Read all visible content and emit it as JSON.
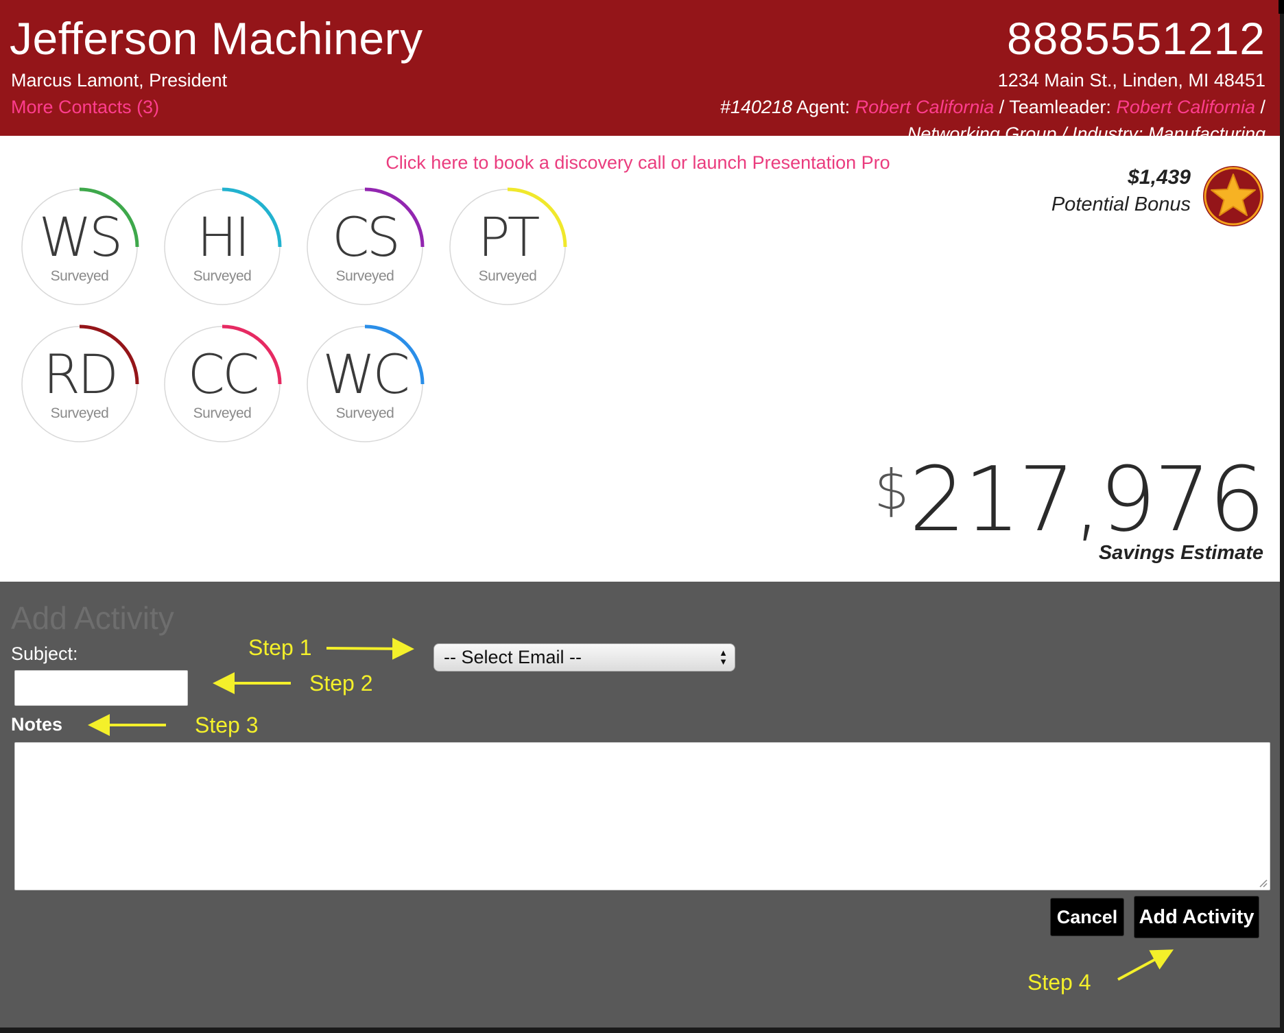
{
  "header": {
    "company": "Jefferson Machinery",
    "contact": "Marcus Lamont, President",
    "more_contacts": "More Contacts (3)",
    "phone": "8885551212",
    "address": "1234 Main St., Linden, MI 48451",
    "account_id": "#140218",
    "agent_label": "Agent:",
    "agent_name": "Robert California",
    "teamleader_label": "/ Teamleader:",
    "teamleader_name": "Robert California",
    "trailing_sep": "/",
    "secondary_line": "Networking Group / Industry: Manufacturing"
  },
  "book_link": "Click here to book a discovery call or launch Presentation Pro",
  "bonus": {
    "amount": "$1,439",
    "label": "Potential Bonus",
    "icon": "star-icon"
  },
  "gauges": [
    {
      "abbr": "WS",
      "status": "Surveyed",
      "color": "#3ea84b",
      "fraction": 0.25
    },
    {
      "abbr": "HI",
      "status": "Surveyed",
      "color": "#22b2cf",
      "fraction": 0.25
    },
    {
      "abbr": "CS",
      "status": "Surveyed",
      "color": "#9226b0",
      "fraction": 0.25
    },
    {
      "abbr": "PT",
      "status": "Surveyed",
      "color": "#f0e82c",
      "fraction": 0.25
    },
    {
      "abbr": "RD",
      "status": "Surveyed",
      "color": "#941519",
      "fraction": 0.25
    },
    {
      "abbr": "CC",
      "status": "Surveyed",
      "color": "#e62a62",
      "fraction": 0.25
    },
    {
      "abbr": "WC",
      "status": "Surveyed",
      "color": "#2a8ee8",
      "fraction": 0.25
    }
  ],
  "savings": {
    "currency": "$",
    "amount": "217,976",
    "label": "Savings Estimate"
  },
  "activity": {
    "title": "Add Activity",
    "subject_label": "Subject:",
    "subject_value": "",
    "email_select": "-- Select Email --",
    "notes_label": "Notes",
    "notes_value": "",
    "cancel_label": "Cancel",
    "add_label": "Add Activity"
  },
  "steps": {
    "step1": "Step 1",
    "step2": "Step 2",
    "step3": "Step 3",
    "step4": "Step 4"
  },
  "colors": {
    "header_bg": "#941519",
    "link_pink": "#ff3d8e",
    "panel_bg": "#595959",
    "annotation_yellow": "#f4f02a"
  }
}
